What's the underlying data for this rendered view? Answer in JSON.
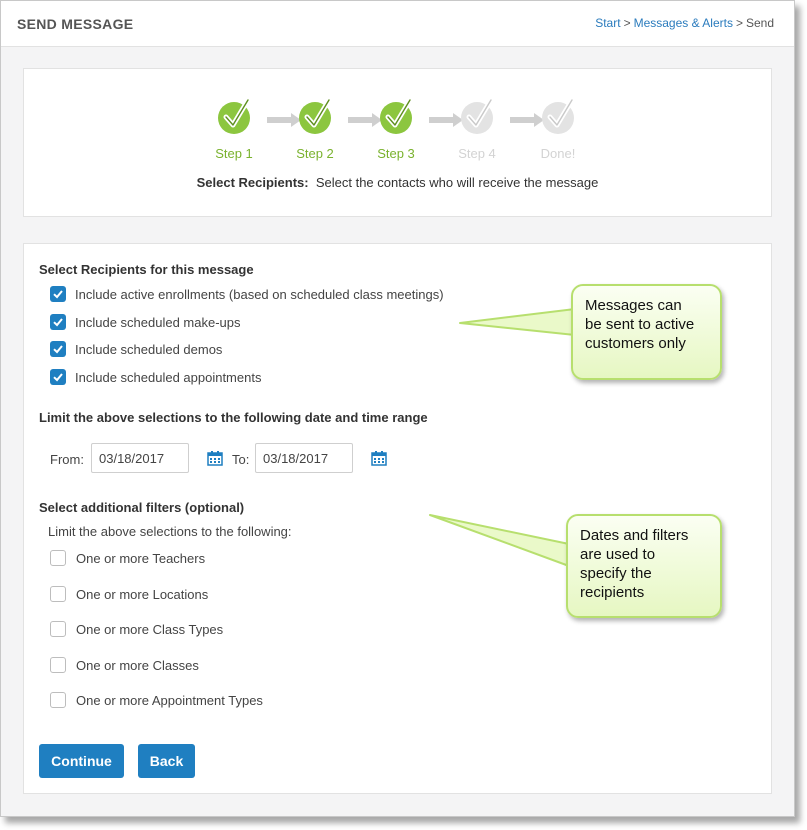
{
  "header": {
    "title": "SEND MESSAGE",
    "breadcrumb": {
      "start": "Start",
      "messages": "Messages & Alerts",
      "current": "Send",
      "sep": ">"
    }
  },
  "steps": [
    {
      "label": "Step 1",
      "state": "done"
    },
    {
      "label": "Step 2",
      "state": "done"
    },
    {
      "label": "Step 3",
      "state": "done"
    },
    {
      "label": "Step 4",
      "state": "todo"
    },
    {
      "label": "Done!",
      "state": "todo"
    }
  ],
  "step_desc": {
    "title": "Select Recipients:",
    "text": "Select the contacts who will receive the message"
  },
  "recipients": {
    "heading": "Select Recipients for this message",
    "options": [
      {
        "label": "Include active enrollments (based on scheduled class meetings)",
        "checked": true
      },
      {
        "label": "Include scheduled make-ups",
        "checked": true
      },
      {
        "label": "Include scheduled demos",
        "checked": true
      },
      {
        "label": "Include scheduled appointments",
        "checked": true
      }
    ]
  },
  "date_range": {
    "heading": "Limit the above selections to the following date and time range",
    "from_label": "From:",
    "from_value": "03/18/2017",
    "to_label": "To:",
    "to_value": "03/18/2017",
    "icon": "calendar-icon"
  },
  "filters": {
    "heading": "Select additional filters (optional)",
    "subheading": "Limit the above selections to the following:",
    "options": [
      {
        "label": "One or more Teachers",
        "checked": false
      },
      {
        "label": "One or more Locations",
        "checked": false
      },
      {
        "label": "One or more Class Types",
        "checked": false
      },
      {
        "label": "One or more Classes",
        "checked": false
      },
      {
        "label": "One or more Appointment Types",
        "checked": false
      }
    ]
  },
  "buttons": {
    "continue": "Continue",
    "back": "Back"
  },
  "callouts": {
    "first": [
      "Messages can",
      "be sent to active",
      "customers only"
    ],
    "second": [
      "Dates and filters",
      "are used to",
      "specify the",
      "recipients"
    ]
  },
  "colors": {
    "accent": "#1f7fc1",
    "step_done": "#8cc63f",
    "step_todo": "#e3e3e3",
    "link": "#2a7bbd",
    "callout_border": "#b7df6e"
  }
}
